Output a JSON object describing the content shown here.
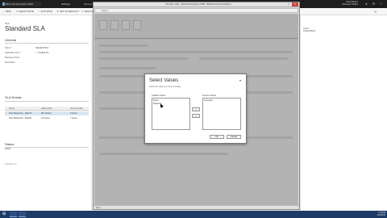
{
  "topbar": {
    "app_title": "Microsoft Dynamics CRM",
    "tabs": [
      "Settings",
      "Service Management",
      "Standard SLA"
    ],
    "user_name": "Trista Adams",
    "user_org": "Adventure Works"
  },
  "commands": {
    "new": "NEW",
    "deactivate": "DEACTIVATE",
    "activate": "ACTIVATE",
    "set_as_default": "SET AS DEFAULT",
    "delete": "DELETE"
  },
  "form": {
    "record_type": "SLA",
    "title": "Standard SLA",
    "general_heading": "General",
    "fields": [
      {
        "label": "Name *",
        "value": "Standard SLA",
        "check": false
      },
      {
        "label": "Applicable From *",
        "value": "Created On",
        "check": true
      },
      {
        "label": "Business Hours",
        "value": "",
        "check": false
      },
      {
        "label": "Description",
        "value": "",
        "check": false
      }
    ],
    "sla_items_heading": "SLA Details",
    "grid_headers": [
      "Name",
      "Failure After",
      "Success After"
    ],
    "grid_rows": [
      {
        "name": "First Response - High Pr...",
        "failure": "30 minutes",
        "success": "2 hours",
        "selected": true
      },
      {
        "name": "First Response - Default",
        "failure": "2.5 hours",
        "success": "7 hours",
        "selected": false
      }
    ],
    "status_heading": "Status",
    "status_value": "Active",
    "footer_text": "Is Default: No"
  },
  "right_panel": {
    "label": "Owner",
    "value": "Trista Adams"
  },
  "browser": {
    "title": "SLA Item: New - Microsoft Dynamics CRM - Windows Internet Explorer",
    "address": "https://...",
    "status_text": "Done"
  },
  "dialog": {
    "title": "Select Values",
    "subtitle": "Select the values you want to display.",
    "available_label": "Available Values",
    "selected_label": "Selected Values",
    "available_items": [
      "Status",
      "Resolved"
    ],
    "selected_items": [
      "Cancelled"
    ],
    "add_arrow": "→",
    "remove_arrow": "←",
    "ok_label": "OK",
    "cancel_label": "Cancel"
  },
  "taskbar": {
    "time": "1:45 PM",
    "date": "11/6/2013"
  },
  "colors": {
    "topbar": "#1e1e1e",
    "taskbar": "#1e3a66",
    "selected_row": "#d7e6f5"
  }
}
